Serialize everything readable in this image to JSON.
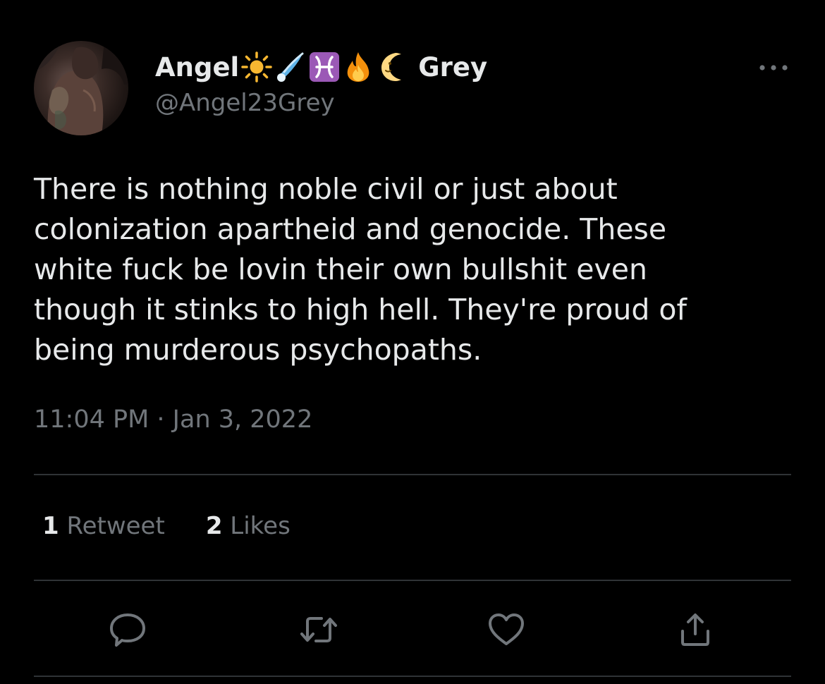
{
  "tweet": {
    "display_name_prefix": "Angel",
    "display_name_suffix": "Grey",
    "display_name_emojis": [
      "sun-emoji",
      "comet-emoji",
      "pisces-emoji",
      "fire-emoji",
      "crescent-moon-face-emoji"
    ],
    "handle": "@Angel23Grey",
    "text": "There is nothing noble civil or just about\ncolonization apartheid and genocide.  These\nwhite fuck be lovin their own bullshit even\nthough it stinks to high hell. They're proud of\nbeing murderous psychopaths.",
    "timestamp": "11:04 PM · Jan 3, 2022",
    "stats": {
      "retweets_count": "1",
      "retweets_label": "Retweet",
      "likes_count": "2",
      "likes_label": "Likes"
    },
    "actions": {
      "reply_icon": "reply-icon",
      "retweet_icon": "retweet-icon",
      "like_icon": "heart-icon",
      "share_icon": "share-icon"
    },
    "more_icon": "more-icon"
  },
  "colors": {
    "background": "#000000",
    "primary_text": "#e7e9ea",
    "secondary_text": "#71767b",
    "divider": "#2f3336"
  }
}
